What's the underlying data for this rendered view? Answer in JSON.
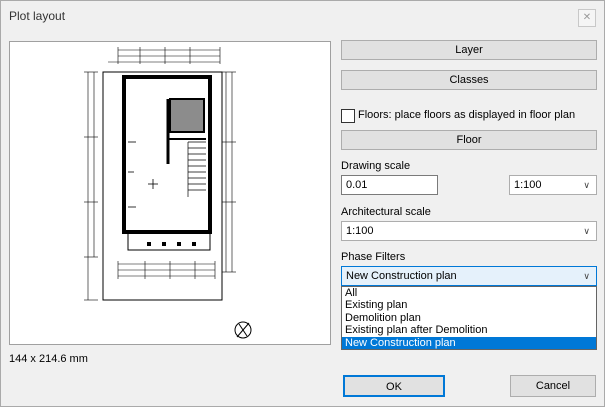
{
  "window": {
    "title": "Plot layout",
    "close_glyph": "✕"
  },
  "preview": {
    "paper_size": "144 x 214.6 mm"
  },
  "buttons": {
    "layer": "Layer",
    "classes": "Classes",
    "floor": "Floor",
    "ok": "OK",
    "cancel": "Cancel"
  },
  "floors_option": {
    "label": "Floors: place floors as displayed in floor plan",
    "checked": false
  },
  "drawing_scale": {
    "label": "Drawing scale",
    "value": "0.01",
    "select_value": "1:100"
  },
  "architectural_scale": {
    "label": "Architectural scale",
    "value": "1:100"
  },
  "phase_filters": {
    "label": "Phase Filters",
    "selected": "New Construction plan",
    "options": [
      "All",
      "Existing plan",
      "Demolition plan",
      "Existing plan after Demolition",
      "New Construction plan"
    ]
  },
  "colors": {
    "accent": "#0078d7",
    "dialog_bg": "#f0f0f0",
    "button_bg": "#e1e1e1"
  }
}
